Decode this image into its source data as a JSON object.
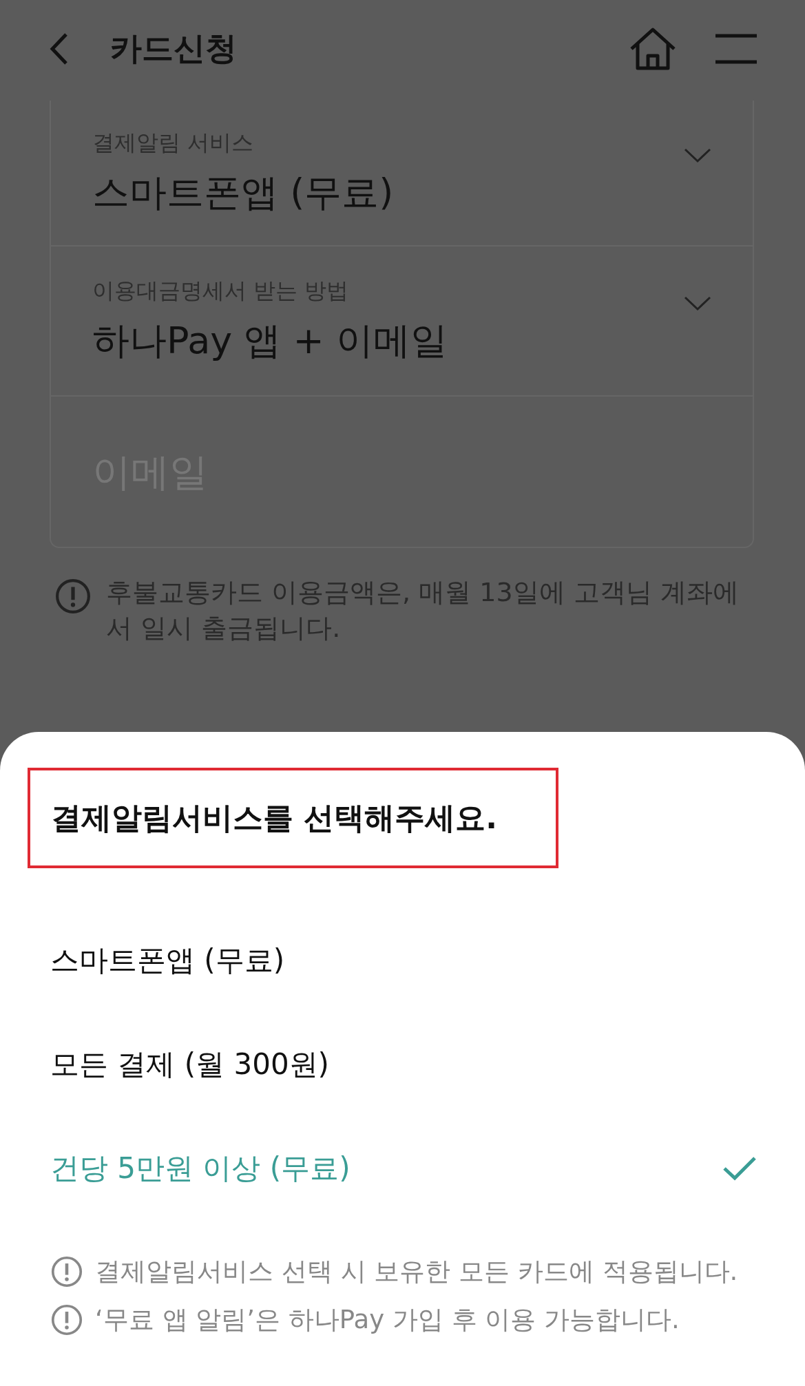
{
  "header": {
    "title": "카드신청"
  },
  "form": {
    "fields": [
      {
        "kind": "select",
        "label": "결제알림 서비스",
        "value": "스마트폰앱 (무료)"
      },
      {
        "kind": "select",
        "label": "이용대금명세서 받는 방법",
        "value": "하나Pay 앱 + 이메일"
      },
      {
        "kind": "input",
        "placeholder": "이메일"
      }
    ]
  },
  "notice": "후불교통카드 이용금액은, 매월 13일에 고객님 계좌에서 일시 출금됩니다.",
  "sheet": {
    "title": "결제알림서비스를 선택해주세요.",
    "title_highlighted": true,
    "options": [
      {
        "label": "스마트폰앱 (무료)",
        "selected": false
      },
      {
        "label": "모든 결제 (월 300원)",
        "selected": false
      },
      {
        "label": "건당 5만원 이상 (무료)",
        "selected": true
      }
    ],
    "notes": [
      "결제알림서비스 선택 시 보유한 모든 카드에 적용됩니다.",
      "‘무료 앱 알림’은 하나Pay 가입 후 이용 가능합니다."
    ]
  }
}
